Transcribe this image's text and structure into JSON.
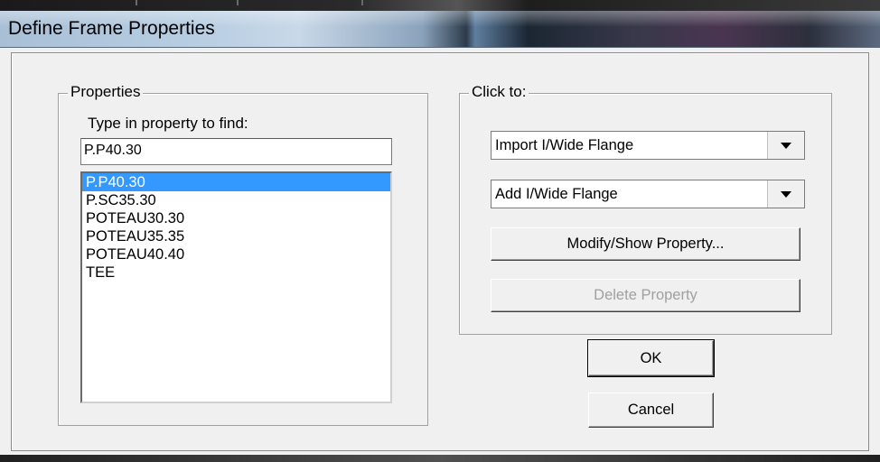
{
  "window": {
    "title": "Define Frame Properties"
  },
  "properties": {
    "group_label": "Properties",
    "find_label": "Type in property to find:",
    "find_value": "P.P40.30",
    "items": [
      "P.P40.30",
      "P.SC35.30",
      "POTEAU30.30",
      "POTEAU35.35",
      "POTEAU40.40",
      "TEE"
    ],
    "selected_index": 0
  },
  "click_to": {
    "group_label": "Click to:",
    "import_select": "Import I/Wide Flange",
    "add_select": "Add I/Wide Flange",
    "modify_label": "Modify/Show Property...",
    "delete_label": "Delete Property"
  },
  "actions": {
    "ok_label": "OK",
    "cancel_label": "Cancel"
  },
  "icons": {
    "dropdown": "chevron-down-icon"
  }
}
